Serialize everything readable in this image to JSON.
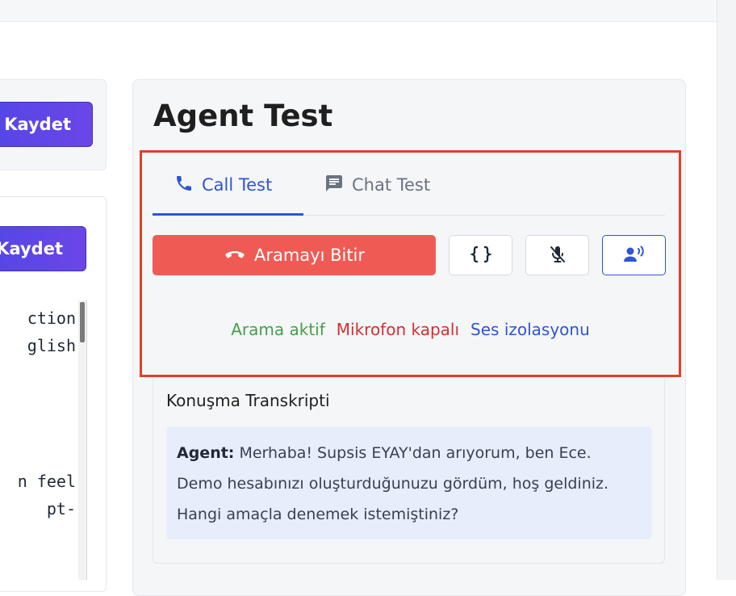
{
  "left": {
    "save_label_1": "Kaydet",
    "save_label_2": "Kaydet",
    "code_lines": [
      "ction",
      "glish",
      "n feel",
      "pt-"
    ]
  },
  "agent": {
    "title": "Agent Test",
    "tabs": [
      {
        "label": "Call Test",
        "icon": "phone-icon",
        "active": true
      },
      {
        "label": "Chat Test",
        "icon": "chat-icon",
        "active": false
      }
    ],
    "end_call_label": "Aramayı Bitir",
    "icon_buttons": [
      "json-braces-icon",
      "mic-off-icon",
      "voice-isolation-icon"
    ],
    "status": {
      "call": "Arama aktif",
      "mic": "Mikrofon kapalı",
      "isolation": "Ses izolasyonu"
    },
    "transcript": {
      "title": "Konuşma Transkripti",
      "speaker": "Agent:",
      "message": "Merhaba! Supsis EYAY'dan arıyorum, ben Ece. Demo hesabınızı oluşturduğunuzu gördüm, hoş geldiniz. Hangi amaçla denemek istemiştiniz?"
    }
  },
  "colors": {
    "accent": "#2f55d4",
    "danger": "#ef5b54",
    "success": "#43a047",
    "highlight": "#e0402a",
    "save_gradient_start": "#4f46e5",
    "save_gradient_end": "#6b46e8"
  }
}
